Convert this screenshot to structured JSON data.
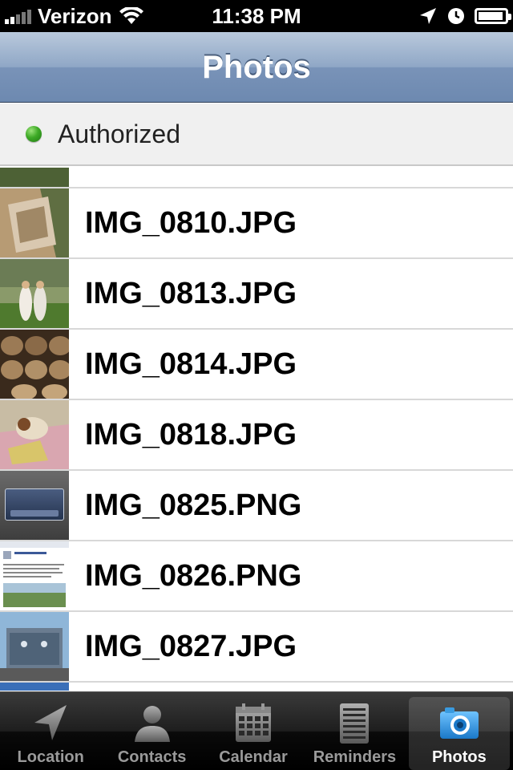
{
  "status_bar": {
    "carrier": "Verizon",
    "time": "11:38 PM",
    "icons": [
      "signal-icon",
      "wifi-icon",
      "location-arrow-icon",
      "clock-icon",
      "battery-icon"
    ]
  },
  "nav_bar": {
    "title": "Photos"
  },
  "auth": {
    "status_text": "Authorized",
    "status_color": "#3eaa26"
  },
  "photos": [
    {
      "filename": "IMG_0810.JPG"
    },
    {
      "filename": "IMG_0813.JPG"
    },
    {
      "filename": "IMG_0814.JPG"
    },
    {
      "filename": "IMG_0818.JPG"
    },
    {
      "filename": "IMG_0825.PNG"
    },
    {
      "filename": "IMG_0826.PNG"
    },
    {
      "filename": "IMG_0827.JPG"
    }
  ],
  "tab_bar": {
    "tabs": [
      {
        "label": "Location",
        "icon": "location-arrow-icon"
      },
      {
        "label": "Contacts",
        "icon": "person-icon"
      },
      {
        "label": "Calendar",
        "icon": "calendar-icon"
      },
      {
        "label": "Reminders",
        "icon": "notepad-icon"
      },
      {
        "label": "Photos",
        "icon": "camera-icon"
      }
    ],
    "active_tab": "Photos",
    "accent": "#2f9ae6"
  }
}
